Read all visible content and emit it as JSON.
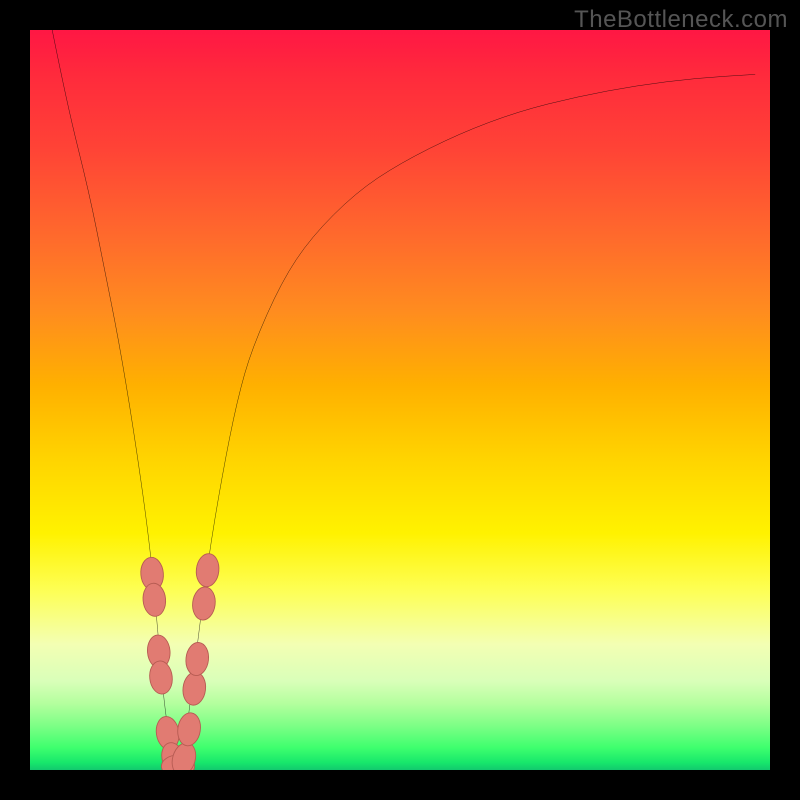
{
  "watermark": "TheBottleneck.com",
  "colors": {
    "frame": "#000000",
    "curve": "#000000",
    "marker_fill": "#e17b72",
    "marker_stroke": "#b65b52"
  },
  "chart_data": {
    "type": "line",
    "title": "",
    "xlabel": "",
    "ylabel": "",
    "xlim": [
      0,
      100
    ],
    "ylim": [
      0,
      100
    ],
    "grid": false,
    "legend": false,
    "series": [
      {
        "name": "bottleneck-curve",
        "x": [
          3,
          5,
          8,
          10,
          12,
          14,
          16,
          17,
          18,
          19,
          20,
          21,
          22,
          24,
          26,
          28,
          30,
          34,
          38,
          44,
          50,
          58,
          66,
          74,
          82,
          90,
          98
        ],
        "y": [
          100,
          90,
          78,
          68,
          58,
          46,
          32,
          22,
          10,
          3,
          0,
          4,
          12,
          28,
          40,
          50,
          57,
          66,
          72,
          78,
          82,
          86,
          89,
          91,
          92.5,
          93.5,
          94
        ]
      }
    ],
    "markers": [
      {
        "x": 16.5,
        "y": 26.5,
        "r": 1.6
      },
      {
        "x": 16.8,
        "y": 23.0,
        "r": 1.6
      },
      {
        "x": 17.4,
        "y": 16.0,
        "r": 1.6
      },
      {
        "x": 17.7,
        "y": 12.5,
        "r": 1.6
      },
      {
        "x": 18.6,
        "y": 5.0,
        "r": 1.6
      },
      {
        "x": 19.4,
        "y": 1.5,
        "r": 1.6
      },
      {
        "x": 20.0,
        "y": 0.5,
        "r": 1.6
      },
      {
        "x": 20.8,
        "y": 1.5,
        "r": 1.6
      },
      {
        "x": 21.5,
        "y": 5.5,
        "r": 1.6
      },
      {
        "x": 22.2,
        "y": 11.0,
        "r": 1.6
      },
      {
        "x": 22.6,
        "y": 15.0,
        "r": 1.6
      },
      {
        "x": 23.5,
        "y": 22.5,
        "r": 1.6
      },
      {
        "x": 24.0,
        "y": 27.0,
        "r": 1.6
      }
    ]
  }
}
